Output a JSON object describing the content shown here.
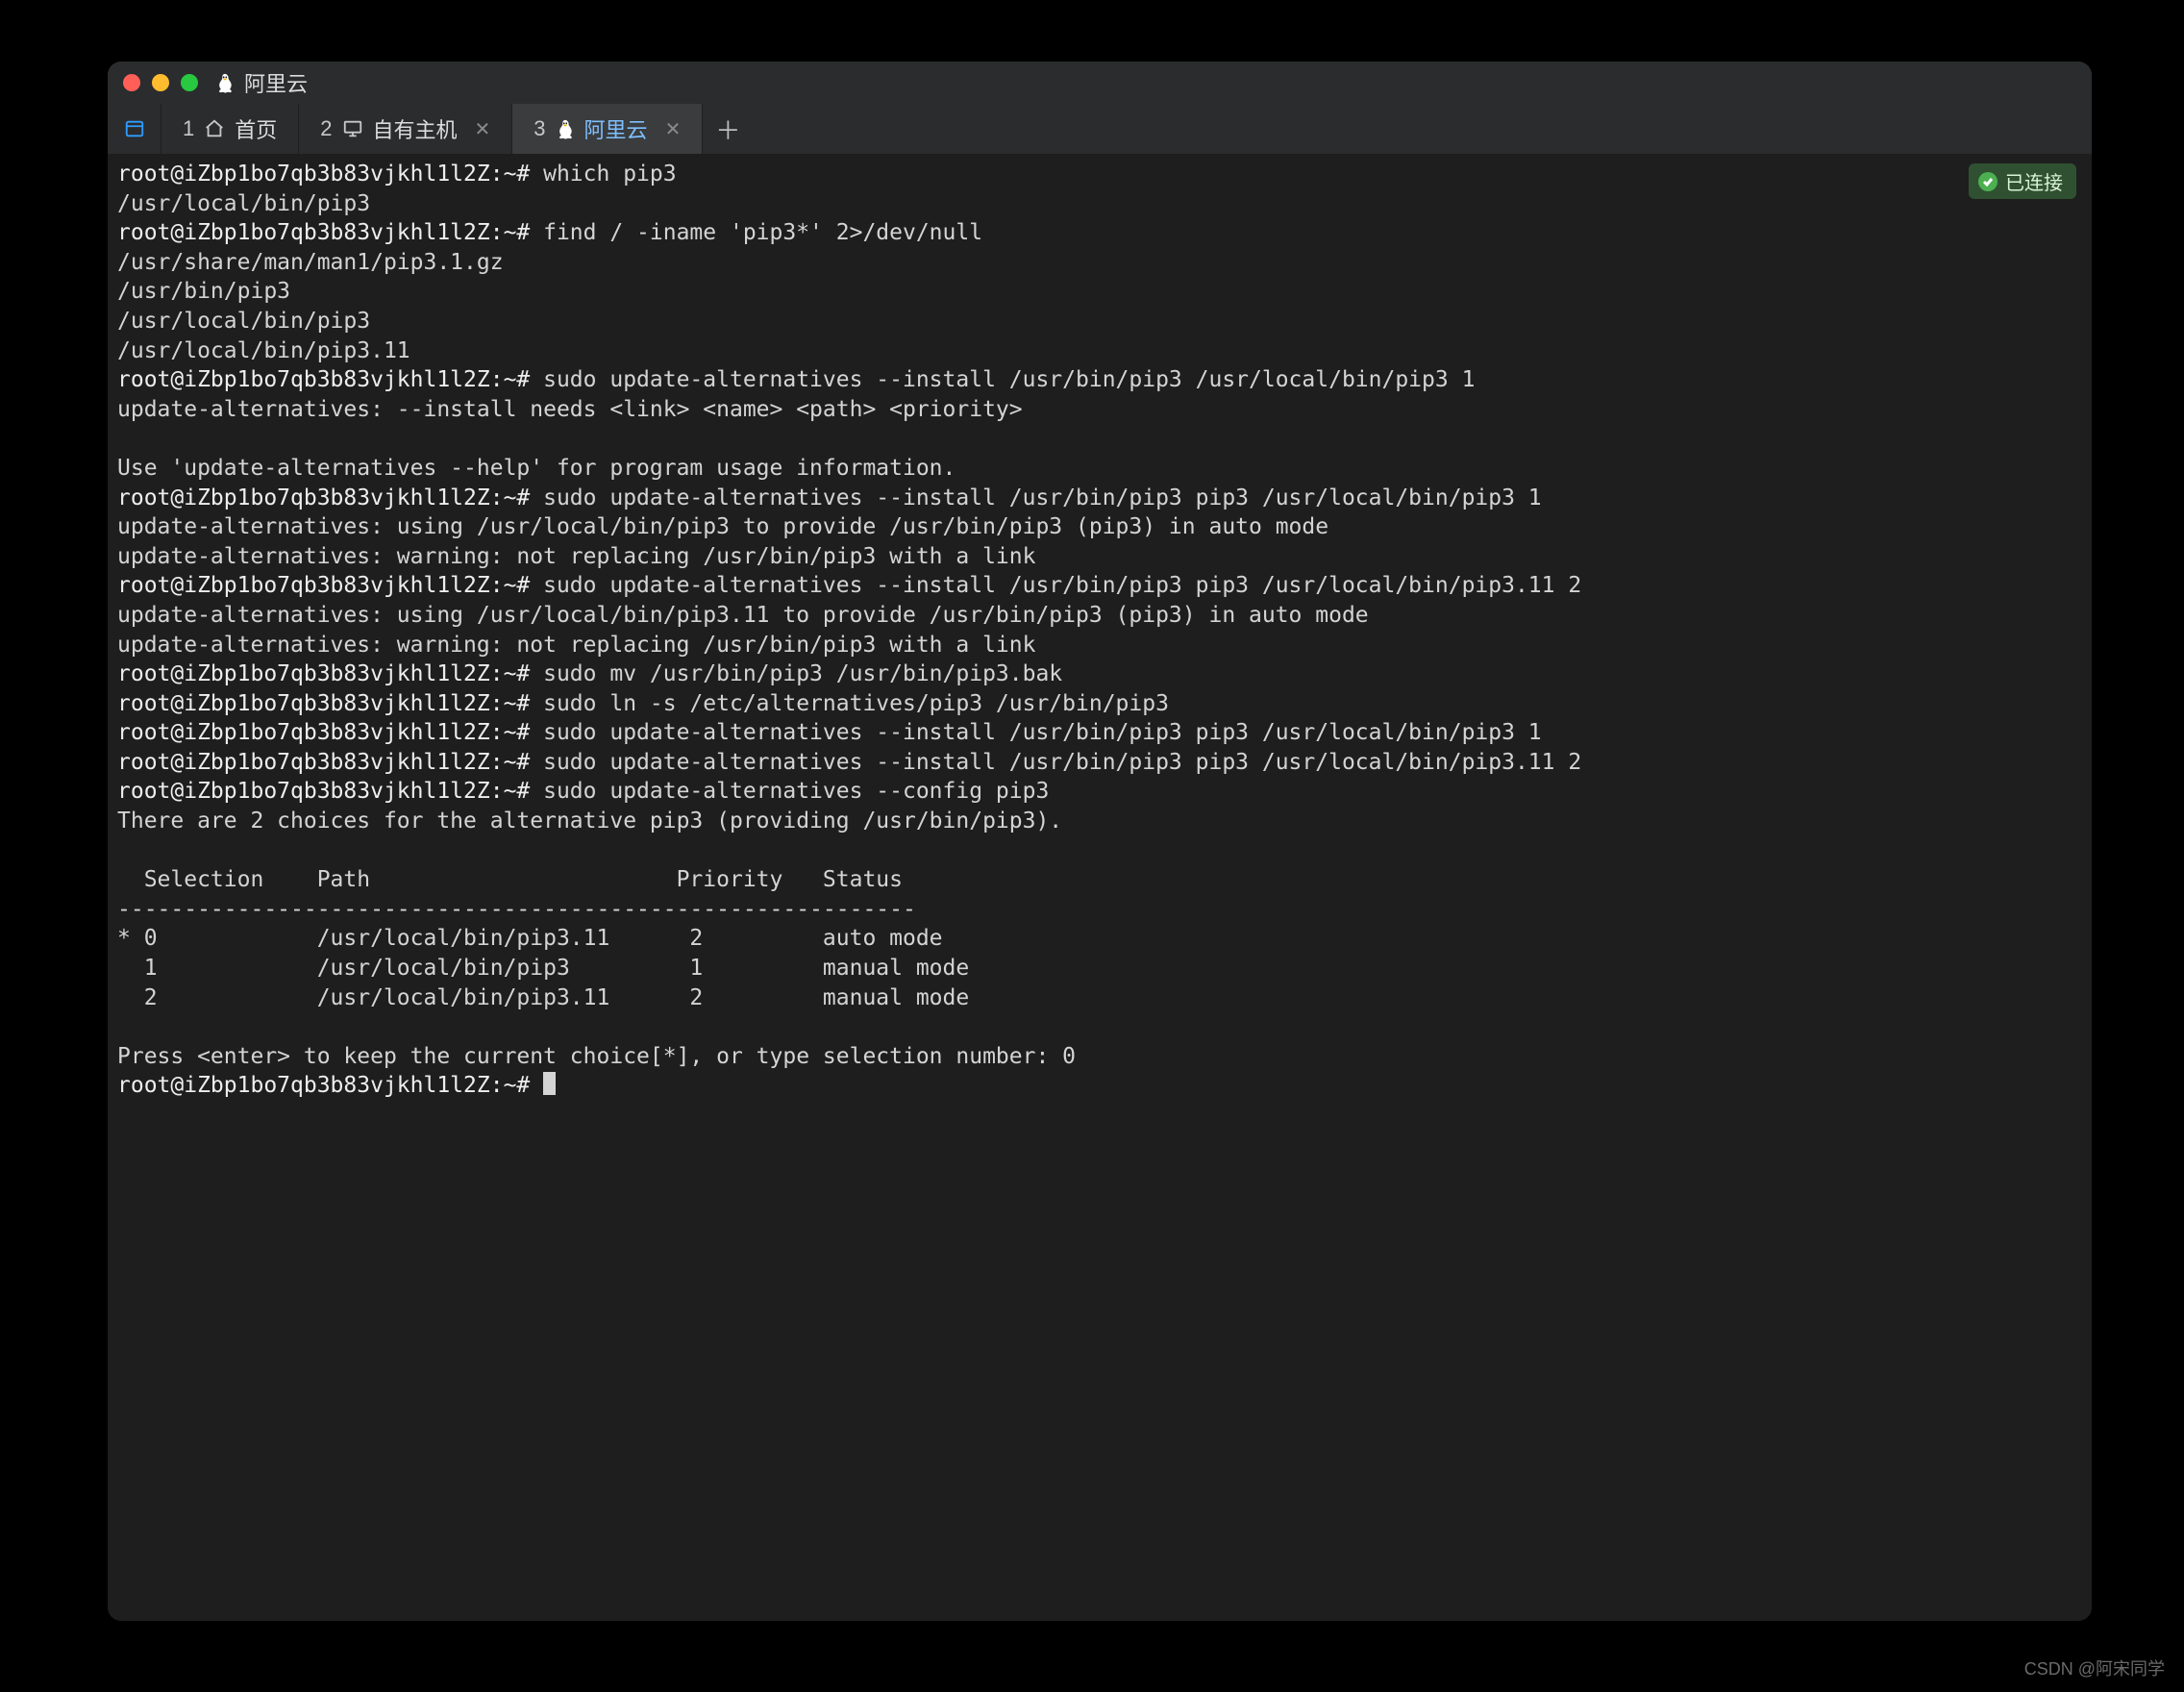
{
  "titlebar": {
    "title": "阿里云"
  },
  "tabs": [
    {
      "index": "1",
      "label": "首页"
    },
    {
      "index": "2",
      "label": "自有主机"
    },
    {
      "index": "3",
      "label": "阿里云"
    }
  ],
  "status": {
    "text": "已连接"
  },
  "prompt": "root@iZbp1bo7qb3b83vjkhl1l2Z:~#",
  "terminal": {
    "lines": [
      {
        "t": "pc",
        "prompt": true,
        "cmd": "which pip3"
      },
      {
        "t": "o",
        "text": "/usr/local/bin/pip3"
      },
      {
        "t": "pc",
        "prompt": true,
        "cmd": "find / -iname 'pip3*' 2>/dev/null"
      },
      {
        "t": "o",
        "text": "/usr/share/man/man1/pip3.1.gz"
      },
      {
        "t": "o",
        "text": "/usr/bin/pip3"
      },
      {
        "t": "o",
        "text": "/usr/local/bin/pip3"
      },
      {
        "t": "o",
        "text": "/usr/local/bin/pip3.11"
      },
      {
        "t": "pc",
        "prompt": true,
        "cmd": "sudo update-alternatives --install /usr/bin/pip3 /usr/local/bin/pip3 1"
      },
      {
        "t": "o",
        "text": "update-alternatives: --install needs <link> <name> <path> <priority>"
      },
      {
        "t": "o",
        "text": ""
      },
      {
        "t": "o",
        "text": "Use 'update-alternatives --help' for program usage information."
      },
      {
        "t": "pc",
        "prompt": true,
        "cmd": "sudo update-alternatives --install /usr/bin/pip3 pip3 /usr/local/bin/pip3 1"
      },
      {
        "t": "o",
        "text": "update-alternatives: using /usr/local/bin/pip3 to provide /usr/bin/pip3 (pip3) in auto mode"
      },
      {
        "t": "o",
        "text": "update-alternatives: warning: not replacing /usr/bin/pip3 with a link"
      },
      {
        "t": "pc",
        "prompt": true,
        "cmd": "sudo update-alternatives --install /usr/bin/pip3 pip3 /usr/local/bin/pip3.11 2"
      },
      {
        "t": "o",
        "text": "update-alternatives: using /usr/local/bin/pip3.11 to provide /usr/bin/pip3 (pip3) in auto mode"
      },
      {
        "t": "o",
        "text": "update-alternatives: warning: not replacing /usr/bin/pip3 with a link"
      },
      {
        "t": "pc",
        "prompt": true,
        "cmd": "sudo mv /usr/bin/pip3 /usr/bin/pip3.bak"
      },
      {
        "t": "pc",
        "prompt": true,
        "cmd": "sudo ln -s /etc/alternatives/pip3 /usr/bin/pip3"
      },
      {
        "t": "pc",
        "prompt": true,
        "cmd": "sudo update-alternatives --install /usr/bin/pip3 pip3 /usr/local/bin/pip3 1"
      },
      {
        "t": "pc",
        "prompt": true,
        "cmd": "sudo update-alternatives --install /usr/bin/pip3 pip3 /usr/local/bin/pip3.11 2"
      },
      {
        "t": "pc",
        "prompt": true,
        "cmd": "sudo update-alternatives --config pip3"
      },
      {
        "t": "o",
        "text": "There are 2 choices for the alternative pip3 (providing /usr/bin/pip3)."
      },
      {
        "t": "o",
        "text": ""
      },
      {
        "t": "o",
        "text": "  Selection    Path                       Priority   Status"
      },
      {
        "t": "o",
        "text": "------------------------------------------------------------"
      },
      {
        "t": "o",
        "text": "* 0            /usr/local/bin/pip3.11      2         auto mode"
      },
      {
        "t": "o",
        "text": "  1            /usr/local/bin/pip3         1         manual mode"
      },
      {
        "t": "o",
        "text": "  2            /usr/local/bin/pip3.11      2         manual mode"
      },
      {
        "t": "o",
        "text": ""
      },
      {
        "t": "o",
        "text": "Press <enter> to keep the current choice[*], or type selection number: 0"
      },
      {
        "t": "pcur",
        "prompt": true,
        "cmd": ""
      }
    ],
    "alternatives_table": {
      "headers": [
        "Selection",
        "Path",
        "Priority",
        "Status"
      ],
      "rows": [
        {
          "marker": "*",
          "selection": 0,
          "path": "/usr/local/bin/pip3.11",
          "priority": 2,
          "status": "auto mode"
        },
        {
          "marker": " ",
          "selection": 1,
          "path": "/usr/local/bin/pip3",
          "priority": 1,
          "status": "manual mode"
        },
        {
          "marker": " ",
          "selection": 2,
          "path": "/usr/local/bin/pip3.11",
          "priority": 2,
          "status": "manual mode"
        }
      ],
      "chosen": 0
    }
  },
  "watermark": "CSDN @阿宋同学"
}
